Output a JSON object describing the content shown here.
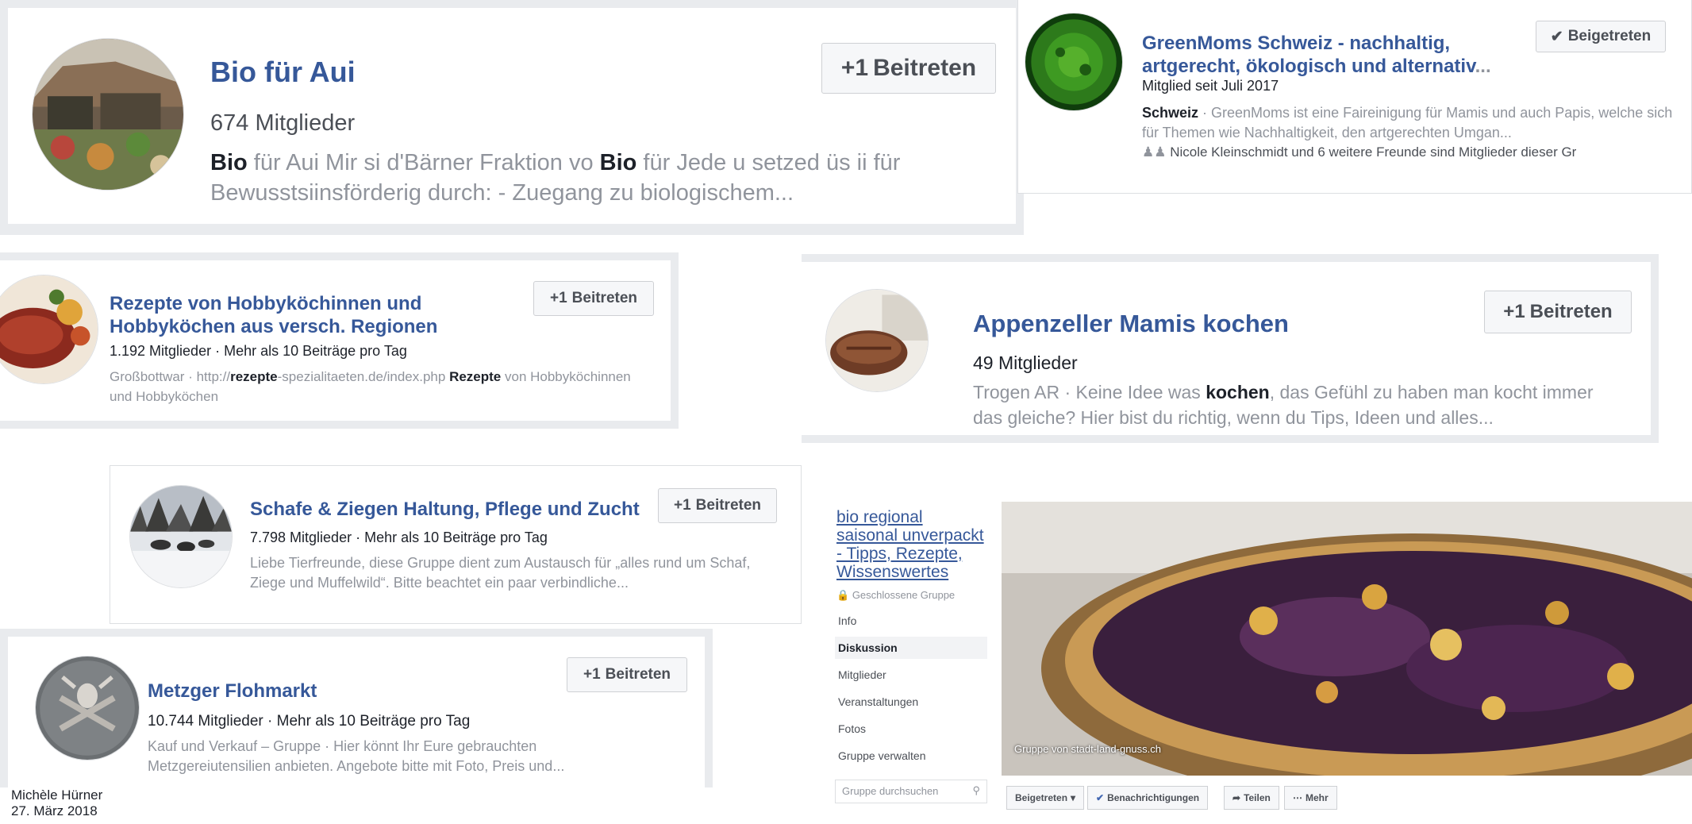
{
  "cards": {
    "bio": {
      "title": "Bio für Aui",
      "members": "674 Mitglieder",
      "desc_b1": "Bio",
      "desc_t1": " für Aui Mir si d'Bärner Fraktion vo ",
      "desc_b2": "Bio",
      "desc_t2": " für Jede u setzed üs ii für Bewusstsiinsförderig durch: - Zuegang zu biologischem",
      "button": "Beitreten"
    },
    "greenmoms": {
      "title": "GreenMoms Schweiz - nachhaltig, artgerecht, ökologisch und alternativ",
      "member_since": "Mitglied seit Juli 2017",
      "desc_b1": "Schweiz",
      "desc_t1": " · GreenMoms ist eine Faireinigung für Mamis und auch Papis, welche sich für Themen wie Nachhaltigkeit, den artgerechten Umgan",
      "friends": "Nicole Kleinschmidt und 6 weitere Freunde sind Mitglieder dieser Gr",
      "button": "Beigetreten"
    },
    "rezepte": {
      "title": "Rezepte von Hobbyköchinnen und Hobbyköchen aus versch. Regionen",
      "members": "1.192 Mitglieder · Mehr als 10 Beiträge pro Tag",
      "desc_t0": "Großbottwar · http://",
      "desc_b1": "rezepte",
      "desc_t1": "-spezialitaeten.de/index.php ",
      "desc_b2": "Rezepte",
      "desc_t2": " von Hobbyköchinnen und Hobbyköchen",
      "button": "Beitreten"
    },
    "appenzeller": {
      "title": "Appenzeller Mamis kochen",
      "members": "49 Mitglieder",
      "desc_t0": "Trogen AR · Keine Idee was ",
      "desc_b1": "kochen",
      "desc_t1": ", das Gefühl zu haben man kocht immer das gleiche? Hier bist du richtig, wenn du Tips, Ideen und alles",
      "button": "Beitreten"
    },
    "schafe": {
      "title": "Schafe & Ziegen Haltung, Pflege und Zucht",
      "members": "7.798 Mitglieder · Mehr als 10 Beiträge pro Tag",
      "desc": "Liebe Tierfreunde, diese Gruppe dient zum Austausch für „alles rund um Schaf, Ziege und Muffelwild“. Bitte beachtet ein paar verbindliche",
      "button": "Beitreten"
    },
    "metzger": {
      "title": "Metzger Flohmarkt",
      "members": "10.744 Mitglieder · Mehr als 10 Beiträge pro Tag",
      "desc": "Kauf und Verkauf – Gruppe · Hier könnt Ihr Eure gebrauchten Metzgereiutensilien anbieten. Angebote bitte mit Foto, Preis und",
      "button": "Beitreten"
    }
  },
  "group_page": {
    "name": "bio regional saisonal unverpackt - Tipps, Rezepte, Wissenswertes",
    "closed_label": "Geschlossene Gruppe",
    "nav": [
      "Info",
      "Diskussion",
      "Mitglieder",
      "Veranstaltungen",
      "Fotos",
      "Gruppe verwalten"
    ],
    "search_placeholder": "Gruppe durchsuchen",
    "cover_caption": "Gruppe von stadt-land-gnuss.ch",
    "actions": {
      "joined": "Beigetreten",
      "notifications": "Benachrichtigungen",
      "share": "Teilen",
      "more": "Mehr"
    }
  },
  "footer": {
    "author": "Michèle Hürner",
    "date": "27. März 2018"
  },
  "colors": {
    "link": "#365899",
    "meta": "#4b4f56",
    "muted": "#90949c",
    "frame": "#e9ebee"
  },
  "icons": {
    "join": "+1",
    "joined": "check",
    "lock": "lock",
    "search": "magnifier",
    "friends": "people"
  }
}
